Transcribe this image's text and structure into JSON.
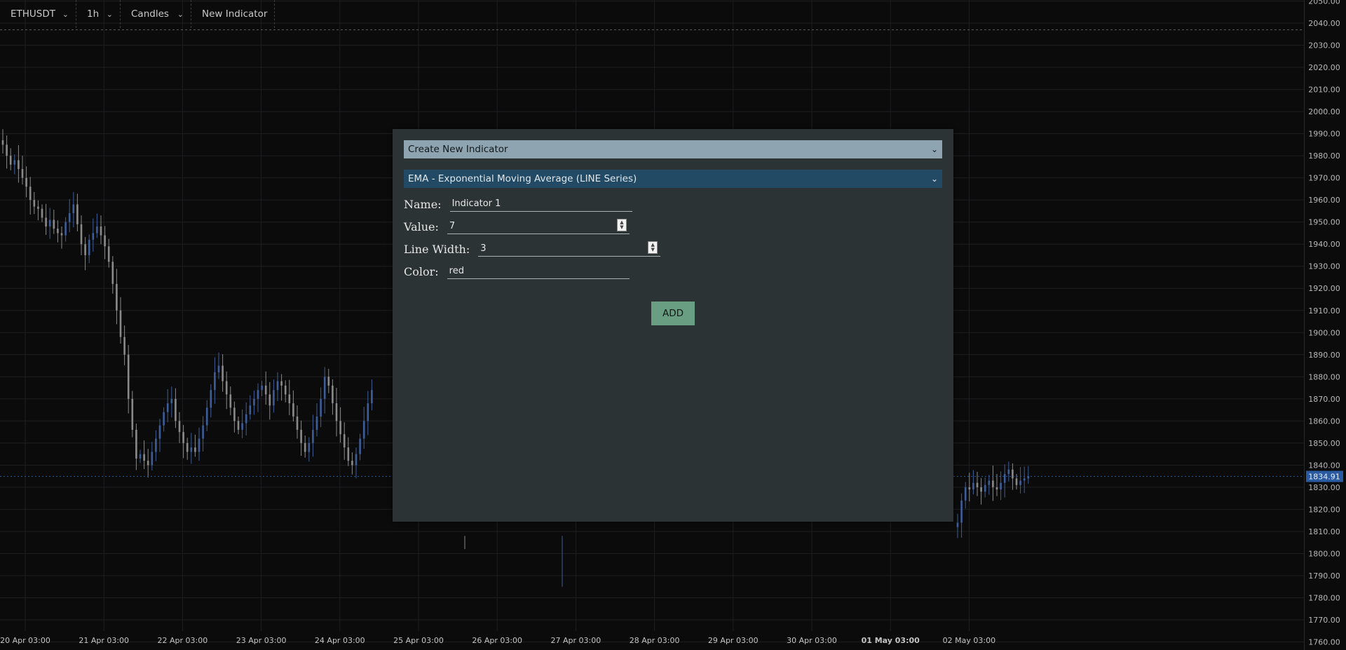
{
  "toolbar": {
    "symbol": "ETHUSDT",
    "interval": "1h",
    "chart_type": "Candles",
    "new_indicator": "New Indicator",
    "dropdown_icon": "chevron-down-icon"
  },
  "modal": {
    "mode_select": "Create New Indicator",
    "indicator_select": "EMA - Exponential Moving Average (LINE Series)",
    "name_label": "Name:",
    "name_value": "Indicator 1",
    "value_label": "Value:",
    "value_value": "7",
    "line_width_label": "Line Width:",
    "line_width_value": "3",
    "color_label": "Color:",
    "color_value": "red",
    "add_button": "ADD"
  },
  "chart_data": {
    "type": "candlestick",
    "x_tick_labels": [
      "20 Apr 03:00",
      "21 Apr 03:00",
      "22 Apr 03:00",
      "23 Apr 03:00",
      "24 Apr 03:00",
      "25 Apr 03:00",
      "26 Apr 03:00",
      "27 Apr 03:00",
      "28 Apr 03:00",
      "29 Apr 03:00",
      "30 Apr 03:00",
      "01 May 03:00",
      "02 May 03:00"
    ],
    "bold_x_tick": "01 May 03:00",
    "y_tick_labels": [
      "2050.00",
      "2040.00",
      "2030.00",
      "2020.00",
      "2010.00",
      "2000.00",
      "1990.00",
      "1980.00",
      "1970.00",
      "1960.00",
      "1950.00",
      "1940.00",
      "1930.00",
      "1920.00",
      "1910.00",
      "1900.00",
      "1890.00",
      "1880.00",
      "1870.00",
      "1860.00",
      "1850.00",
      "1840.00",
      "1830.00",
      "1820.00",
      "1810.00",
      "1800.00",
      "1790.00",
      "1780.00",
      "1770.00",
      "1760.00"
    ],
    "ylim": [
      1757,
      2050
    ],
    "last_price": "1834.91",
    "last_price_value": 1834.91,
    "dashed_level": 2037,
    "grid": true,
    "up_color": "#3d5e9a",
    "down_color": "#8a8a8a",
    "price_label_color": "#2a5aa0",
    "closes": [
      1985,
      1980,
      1976,
      1978,
      1974,
      1970,
      1966,
      1960,
      1957,
      1956,
      1952,
      1948,
      1951,
      1947,
      1945,
      1944,
      1950,
      1954,
      1958,
      1949,
      1940,
      1935,
      1942,
      1945,
      1948,
      1944,
      1939,
      1932,
      1922,
      1910,
      1898,
      1890,
      1870,
      1856,
      1843,
      1845,
      1842,
      1840,
      1846,
      1852,
      1858,
      1864,
      1868,
      1870,
      1860,
      1855,
      1850,
      1846,
      1848,
      1846,
      1852,
      1858,
      1866,
      1874,
      1882,
      1885,
      1878,
      1872,
      1866,
      1860,
      1856,
      1859,
      1863,
      1867,
      1870,
      1874,
      1876,
      1872,
      1867,
      1874,
      1878,
      1876,
      1872,
      1868,
      1862,
      1856,
      1850,
      1846,
      1850,
      1856,
      1862,
      1870,
      1880,
      1876,
      1868,
      1860,
      1854,
      1848,
      1842,
      1840,
      1845,
      1852,
      1860,
      1868,
      1874
    ],
    "visible_closes_right": [
      1814,
      1824,
      1830,
      1829,
      1832,
      1830,
      1828,
      1831,
      1833,
      1830,
      1829,
      1832,
      1836,
      1838,
      1834,
      1831,
      1833,
      1834,
      1835
    ]
  }
}
